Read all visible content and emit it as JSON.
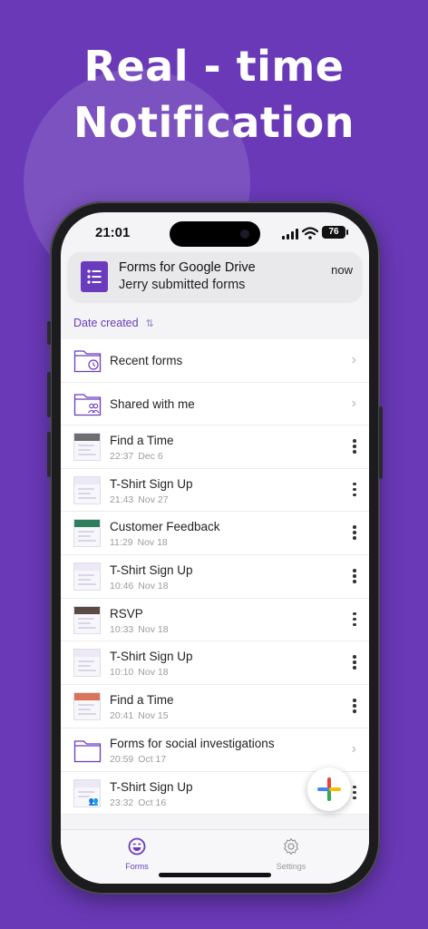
{
  "headline": {
    "line1": "Real - time",
    "line2": "Notification"
  },
  "status_bar": {
    "time": "21:01",
    "battery": "76"
  },
  "notification": {
    "app": "Forms for Google Drive",
    "message": "Jerry submitted forms",
    "time": "now",
    "icon": "forms-doc-icon"
  },
  "sort": {
    "label": "Date created",
    "icon": "sort-arrows-icon"
  },
  "folders": [
    {
      "label": "Recent forms",
      "icon": "clock-folder-icon"
    },
    {
      "label": "Shared with me",
      "icon": "people-folder-icon"
    }
  ],
  "forms": [
    {
      "title": "Find a Time",
      "time": "22:37",
      "date": "Dec 6"
    },
    {
      "title": "T-Shirt Sign Up",
      "time": "21:43",
      "date": "Nov 27"
    },
    {
      "title": "Customer Feedback",
      "time": "11:29",
      "date": "Nov 18"
    },
    {
      "title": "T-Shirt Sign Up",
      "time": "10:46",
      "date": "Nov 18"
    },
    {
      "title": "RSVP",
      "time": "10:33",
      "date": "Nov 18"
    },
    {
      "title": "T-Shirt Sign Up",
      "time": "10:10",
      "date": "Nov 18"
    },
    {
      "title": "Find a Time",
      "time": "20:41",
      "date": "Nov 15"
    },
    {
      "title": "Forms for social investigations",
      "time": "20:59",
      "date": "Oct 17"
    },
    {
      "title": "T-Shirt Sign Up",
      "time": "23:32",
      "date": "Oct 16"
    }
  ],
  "tabs": [
    {
      "label": "Forms",
      "icon": "smiley-icon",
      "active": true
    },
    {
      "label": "Settings",
      "icon": "gear-icon",
      "active": false
    }
  ],
  "colors": {
    "brand": "#6a39b8",
    "accent": "#6a3bbd",
    "fab_blue": "#4285f4",
    "fab_red": "#ea4335",
    "fab_yellow": "#fbbc05",
    "fab_green": "#34a853"
  }
}
